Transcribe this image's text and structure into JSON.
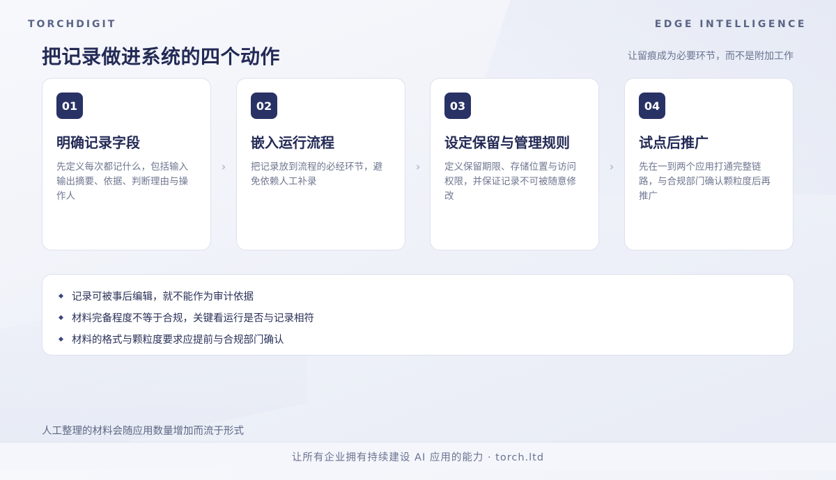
{
  "header": {
    "brand": "TORCHDIGIT",
    "tag": "EDGE INTELLIGENCE",
    "title": "把记录做进系统的四个动作",
    "subtitle": "让留痕成为必要环节，而不是附加工作"
  },
  "steps": [
    {
      "num": "01",
      "title": "明确记录字段",
      "desc": "先定义每次都记什么，包括输入输出摘要、依据、判断理由与操作人"
    },
    {
      "num": "02",
      "title": "嵌入运行流程",
      "desc": "把记录放到流程的必经环节，避免依赖人工补录"
    },
    {
      "num": "03",
      "title": "设定保留与管理规则",
      "desc": "定义保留期限、存储位置与访问权限，并保证记录不可被随意修改"
    },
    {
      "num": "04",
      "title": "试点后推广",
      "desc": "先在一到两个应用打通完整链路，与合规部门确认颗粒度后再推广"
    }
  ],
  "notes": [
    "记录可被事后编辑，就不能作为审计依据",
    "材料完备程度不等于合规，关键看运行是否与记录相符",
    "材料的格式与颗粒度要求应提前与合规部门确认"
  ],
  "footnote": "人工整理的材料会随应用数量增加而流于形式",
  "footer": "让所有企业拥有持续建设 AI 应用的能力 · torch.ltd"
}
